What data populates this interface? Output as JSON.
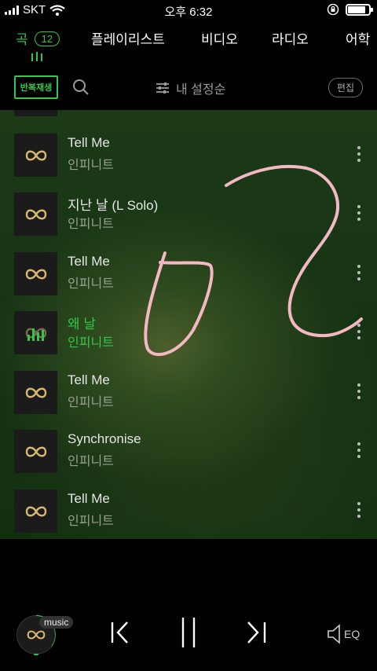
{
  "status_bar": {
    "carrier": "SKT",
    "time": "오후 6:32"
  },
  "tabs": [
    {
      "label": "곡",
      "badge": "12"
    },
    {
      "label": "플레이리스트"
    },
    {
      "label": "비디오"
    },
    {
      "label": "라디오"
    },
    {
      "label": "어학"
    }
  ],
  "toolbar": {
    "repeat_label": "반복재생",
    "sort_label": "내 설정순",
    "edit_label": "편집"
  },
  "songs": [
    {
      "title": "Tell Me",
      "artist": "인피니트"
    },
    {
      "title": "지난 날 (L Solo)",
      "artist": "인피니트"
    },
    {
      "title": "Tell Me",
      "artist": "인피니트"
    },
    {
      "title": "왜 날",
      "artist": "인피니트"
    },
    {
      "title": "Tell Me",
      "artist": "인피니트"
    },
    {
      "title": "Synchronise",
      "artist": "인피니트"
    },
    {
      "title": "Tell Me",
      "artist": "인피니트"
    }
  ],
  "player": {
    "app_tag": "music",
    "eq_label": "EQ"
  },
  "colors": {
    "accent": "#32c846",
    "scribble": "#f4b8c4"
  }
}
